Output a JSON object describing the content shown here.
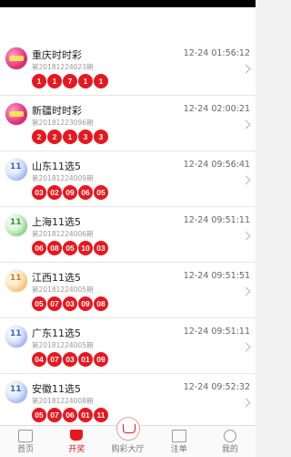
{
  "colors": {
    "ball_red": "#e8171f",
    "active_tab": "#e8171f"
  },
  "lotteries": [
    {
      "name": "重庆时时彩",
      "time": "12-24 01:56:12",
      "period": "第20181224023期",
      "numbers": [
        "1",
        "1",
        "7",
        "1",
        "1"
      ],
      "logo": "ssc-icon"
    },
    {
      "name": "新疆时时彩",
      "time": "12-24 02:00:21",
      "period": "第20181223096期",
      "numbers": [
        "2",
        "2",
        "1",
        "3",
        "3"
      ],
      "logo": "ssc-icon"
    },
    {
      "name": "山东11选5",
      "time": "12-24 09:56:41",
      "period": "第20181224009期",
      "numbers": [
        "03",
        "02",
        "09",
        "06",
        "05"
      ],
      "logo": "11x5-icon"
    },
    {
      "name": "上海11选5",
      "time": "12-24 09:51:11",
      "period": "第20181224006期",
      "numbers": [
        "06",
        "08",
        "05",
        "10",
        "03"
      ],
      "logo": "11x5-icon"
    },
    {
      "name": "江西11选5",
      "time": "12-24 09:51:51",
      "period": "第20181224005期",
      "numbers": [
        "05",
        "07",
        "03",
        "09",
        "08"
      ],
      "logo": "11x5-icon"
    },
    {
      "name": "广东11选5",
      "time": "12-24 09:51:11",
      "period": "第20181224005期",
      "numbers": [
        "04",
        "07",
        "03",
        "01",
        "09"
      ],
      "logo": "11x5-icon"
    },
    {
      "name": "安徽11选5",
      "time": "12-24 09:52:32",
      "period": "第20181224008期",
      "numbers": [
        "05",
        "07",
        "06",
        "01",
        "11"
      ],
      "logo": "11x5-icon"
    }
  ],
  "tabs": [
    {
      "label": "首页",
      "icon": "home-icon"
    },
    {
      "label": "开奖",
      "icon": "lottery-open-icon",
      "active": true
    },
    {
      "label": "购彩大厅",
      "icon": "cart-icon"
    },
    {
      "label": "注单",
      "icon": "note-icon"
    },
    {
      "label": "我的",
      "icon": "user-icon"
    }
  ]
}
